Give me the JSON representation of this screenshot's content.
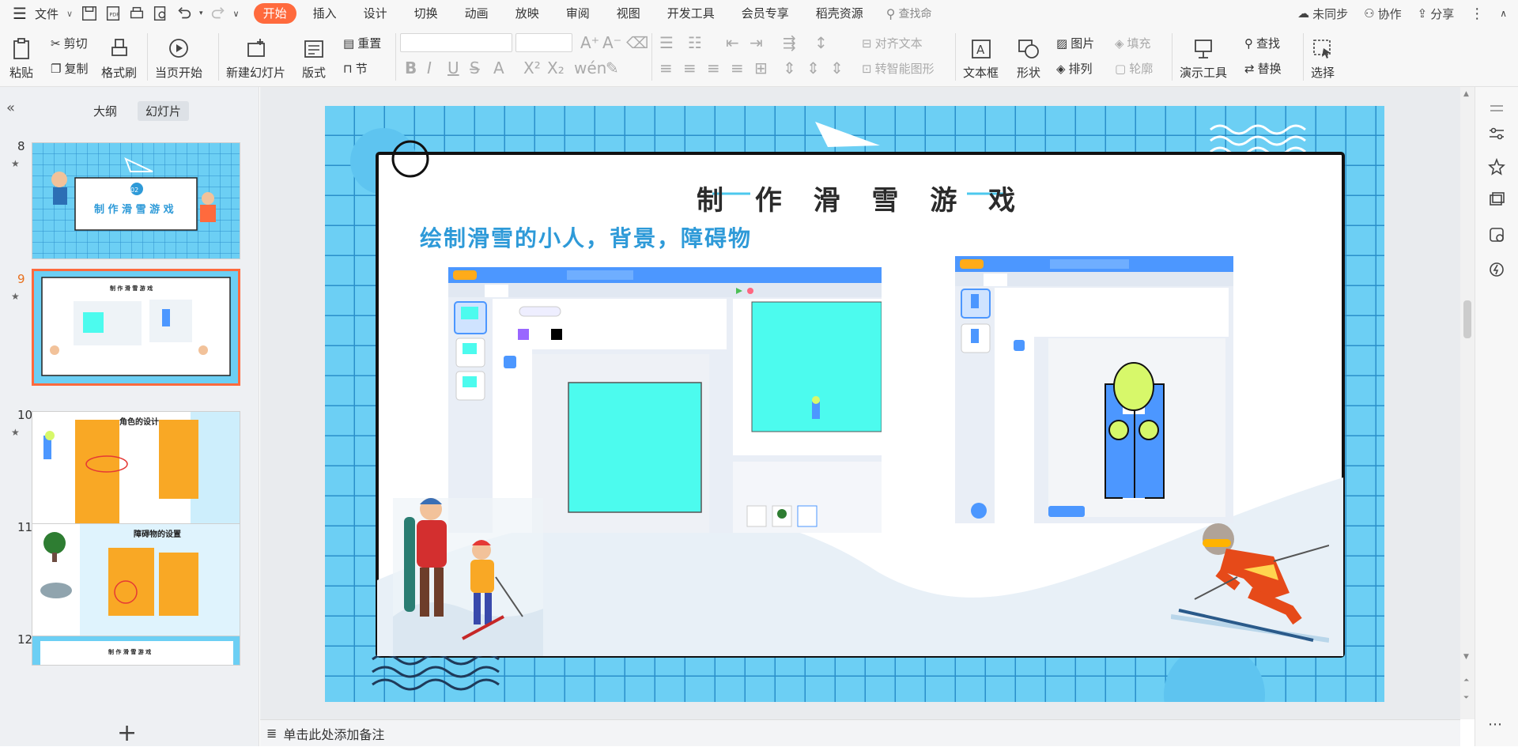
{
  "menu": {
    "file": "文件",
    "tabs": [
      "开始",
      "插入",
      "设计",
      "切换",
      "动画",
      "放映",
      "审阅",
      "视图",
      "开发工具",
      "会员专享",
      "稻壳资源"
    ],
    "active_tab": 0,
    "search": "查找命",
    "unsynced": "未同步",
    "collab": "协作",
    "share": "分享"
  },
  "ribbon": {
    "paste": "粘贴",
    "cut": "剪切",
    "copy": "复制",
    "format_painter": "格式刷",
    "from_current": "当页开始",
    "new_slide": "新建幻灯片",
    "layout": "版式",
    "reset": "重置",
    "section": "节",
    "align_text": "对齐文本",
    "smart_art": "转智能图形",
    "text_box": "文本框",
    "shape": "形状",
    "picture": "图片",
    "fill": "填充",
    "arrange": "排列",
    "outline": "轮廓",
    "present_tool": "演示工具",
    "find": "查找",
    "replace": "替换",
    "select": "选择"
  },
  "left_panel": {
    "tab_outline": "大纲",
    "tab_slides": "幻灯片",
    "slides": [
      {
        "num": "8",
        "title": "制 作 滑 雪 游 戏",
        "badge": "02"
      },
      {
        "num": "9",
        "title": "制 作 滑 雪 游 戏"
      },
      {
        "num": "10",
        "title": "角色的设计"
      },
      {
        "num": "11",
        "title": "障碍物的设置"
      },
      {
        "num": "12",
        "title": "制 作 滑 雪 游 戏"
      }
    ],
    "selected": "9"
  },
  "slide": {
    "title": "制 作 滑 雪 游 戏",
    "subtitle": "绘制滑雪的小人，背景，障碍物"
  },
  "notes_placeholder": "单击此处添加备注",
  "colors": {
    "accent": "#ff6a3d",
    "slide_bg": "#6ccff4",
    "cyan": "#4cfbee",
    "scratch_blue": "#4c97ff",
    "character_yellow": "#d7f86a"
  }
}
